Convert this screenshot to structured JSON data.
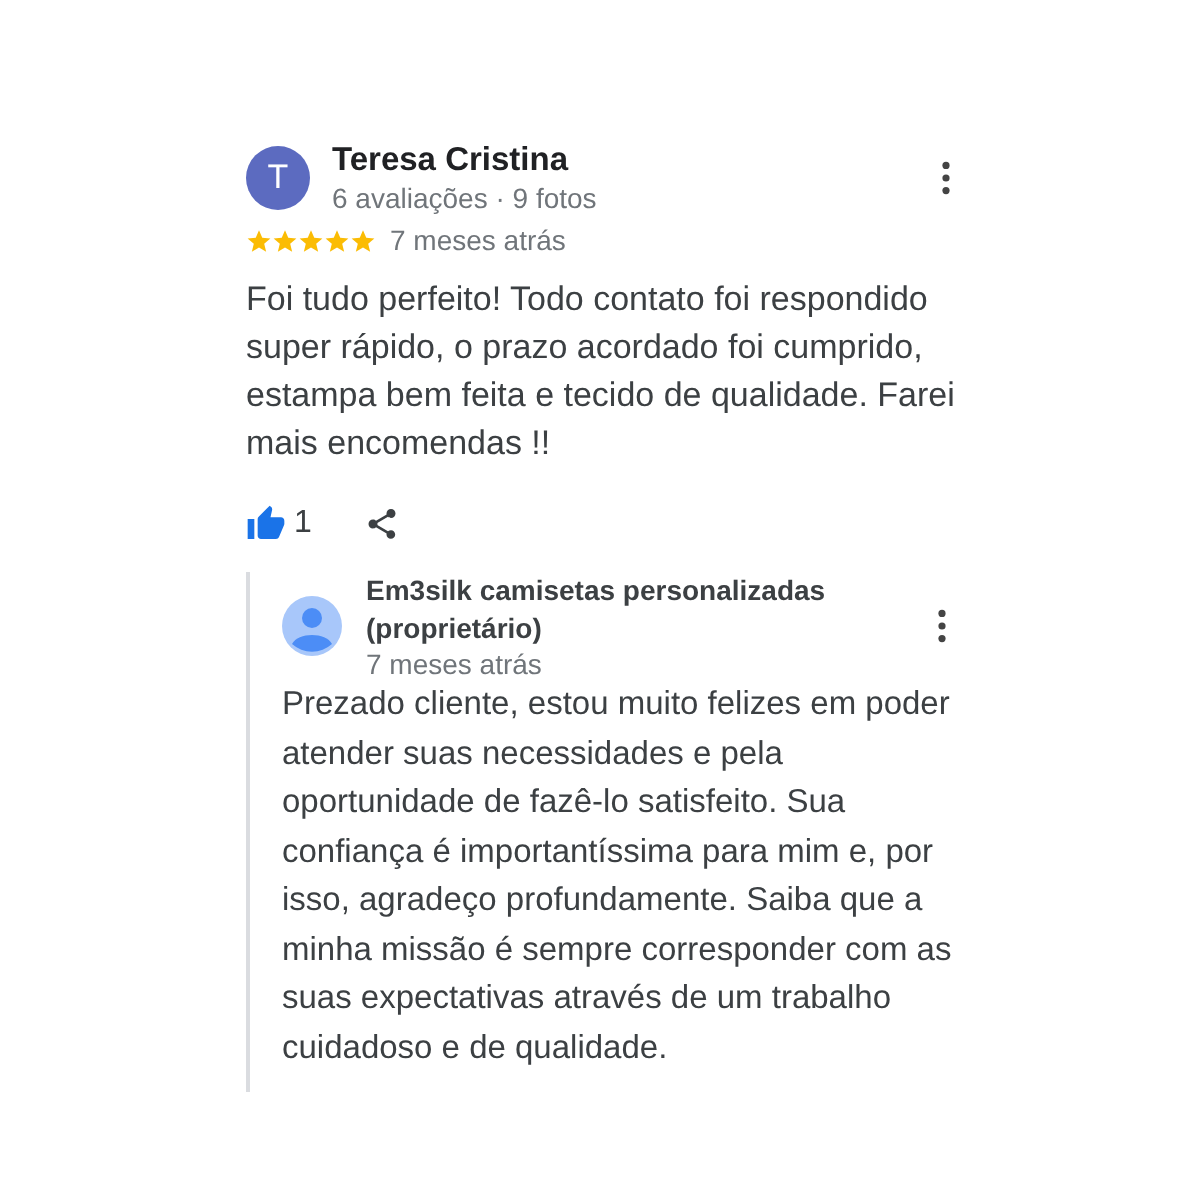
{
  "review": {
    "author": "Teresa Cristina",
    "initial": "T",
    "meta": "6 avaliações · 9 fotos",
    "stars": 5,
    "time": "7 meses atrás",
    "text": "Foi tudo perfeito! Todo contato foi respondido super rápido, o prazo acordado foi cumprido, estampa bem feita e tecido de qualidade. Farei mais encomendas !!",
    "likes": "1",
    "liked": true
  },
  "reply": {
    "author": "Em3silk camisetas personalizadas (proprietário)",
    "time": "7 meses atrás",
    "text": "Prezado cliente, estou muito felizes em poder atender suas necessidades e pela oportunidade de fazê-lo satisfeito. Sua confiança é importantíssima para mim e, por isso, agradeço profundamente. Saiba que a minha missão é sempre corresponder com as suas expectativas através de um trabalho cuidadoso e de qualidade."
  }
}
